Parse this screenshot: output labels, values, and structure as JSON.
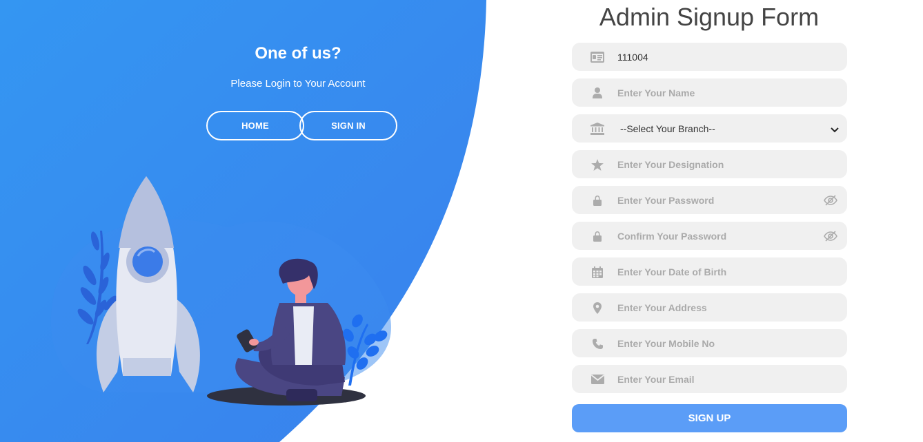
{
  "left": {
    "title": "One of us?",
    "subtitle": "Please Login to Your Account",
    "home_label": "HOME",
    "signin_label": "SIGN IN"
  },
  "form": {
    "title": "Admin Signup Form",
    "id_value": "111004",
    "name_placeholder": "Enter Your Name",
    "branch_selected": "--Select Your Branch--",
    "designation_placeholder": "Enter Your Designation",
    "password_placeholder": "Enter Your Password",
    "confirm_placeholder": "Confirm Your Password",
    "dob_placeholder": "Enter Your Date of Birth",
    "address_placeholder": "Enter Your Address",
    "mobile_placeholder": "Enter Your Mobile No",
    "email_placeholder": "Enter Your Email",
    "submit_label": "SIGN UP"
  },
  "icons": [
    "id-card-icon",
    "user-icon",
    "bank-icon",
    "star-icon",
    "lock-icon",
    "lock-icon",
    "calendar-icon",
    "map-pin-icon",
    "phone-icon",
    "envelope-icon",
    "eye-slash-icon",
    "chevron-down-icon"
  ],
  "colors": {
    "panel_blue": "#3a8cf0",
    "field_bg": "#f0f0f0",
    "button_blue": "#5b9df7",
    "title_text": "#444444"
  }
}
